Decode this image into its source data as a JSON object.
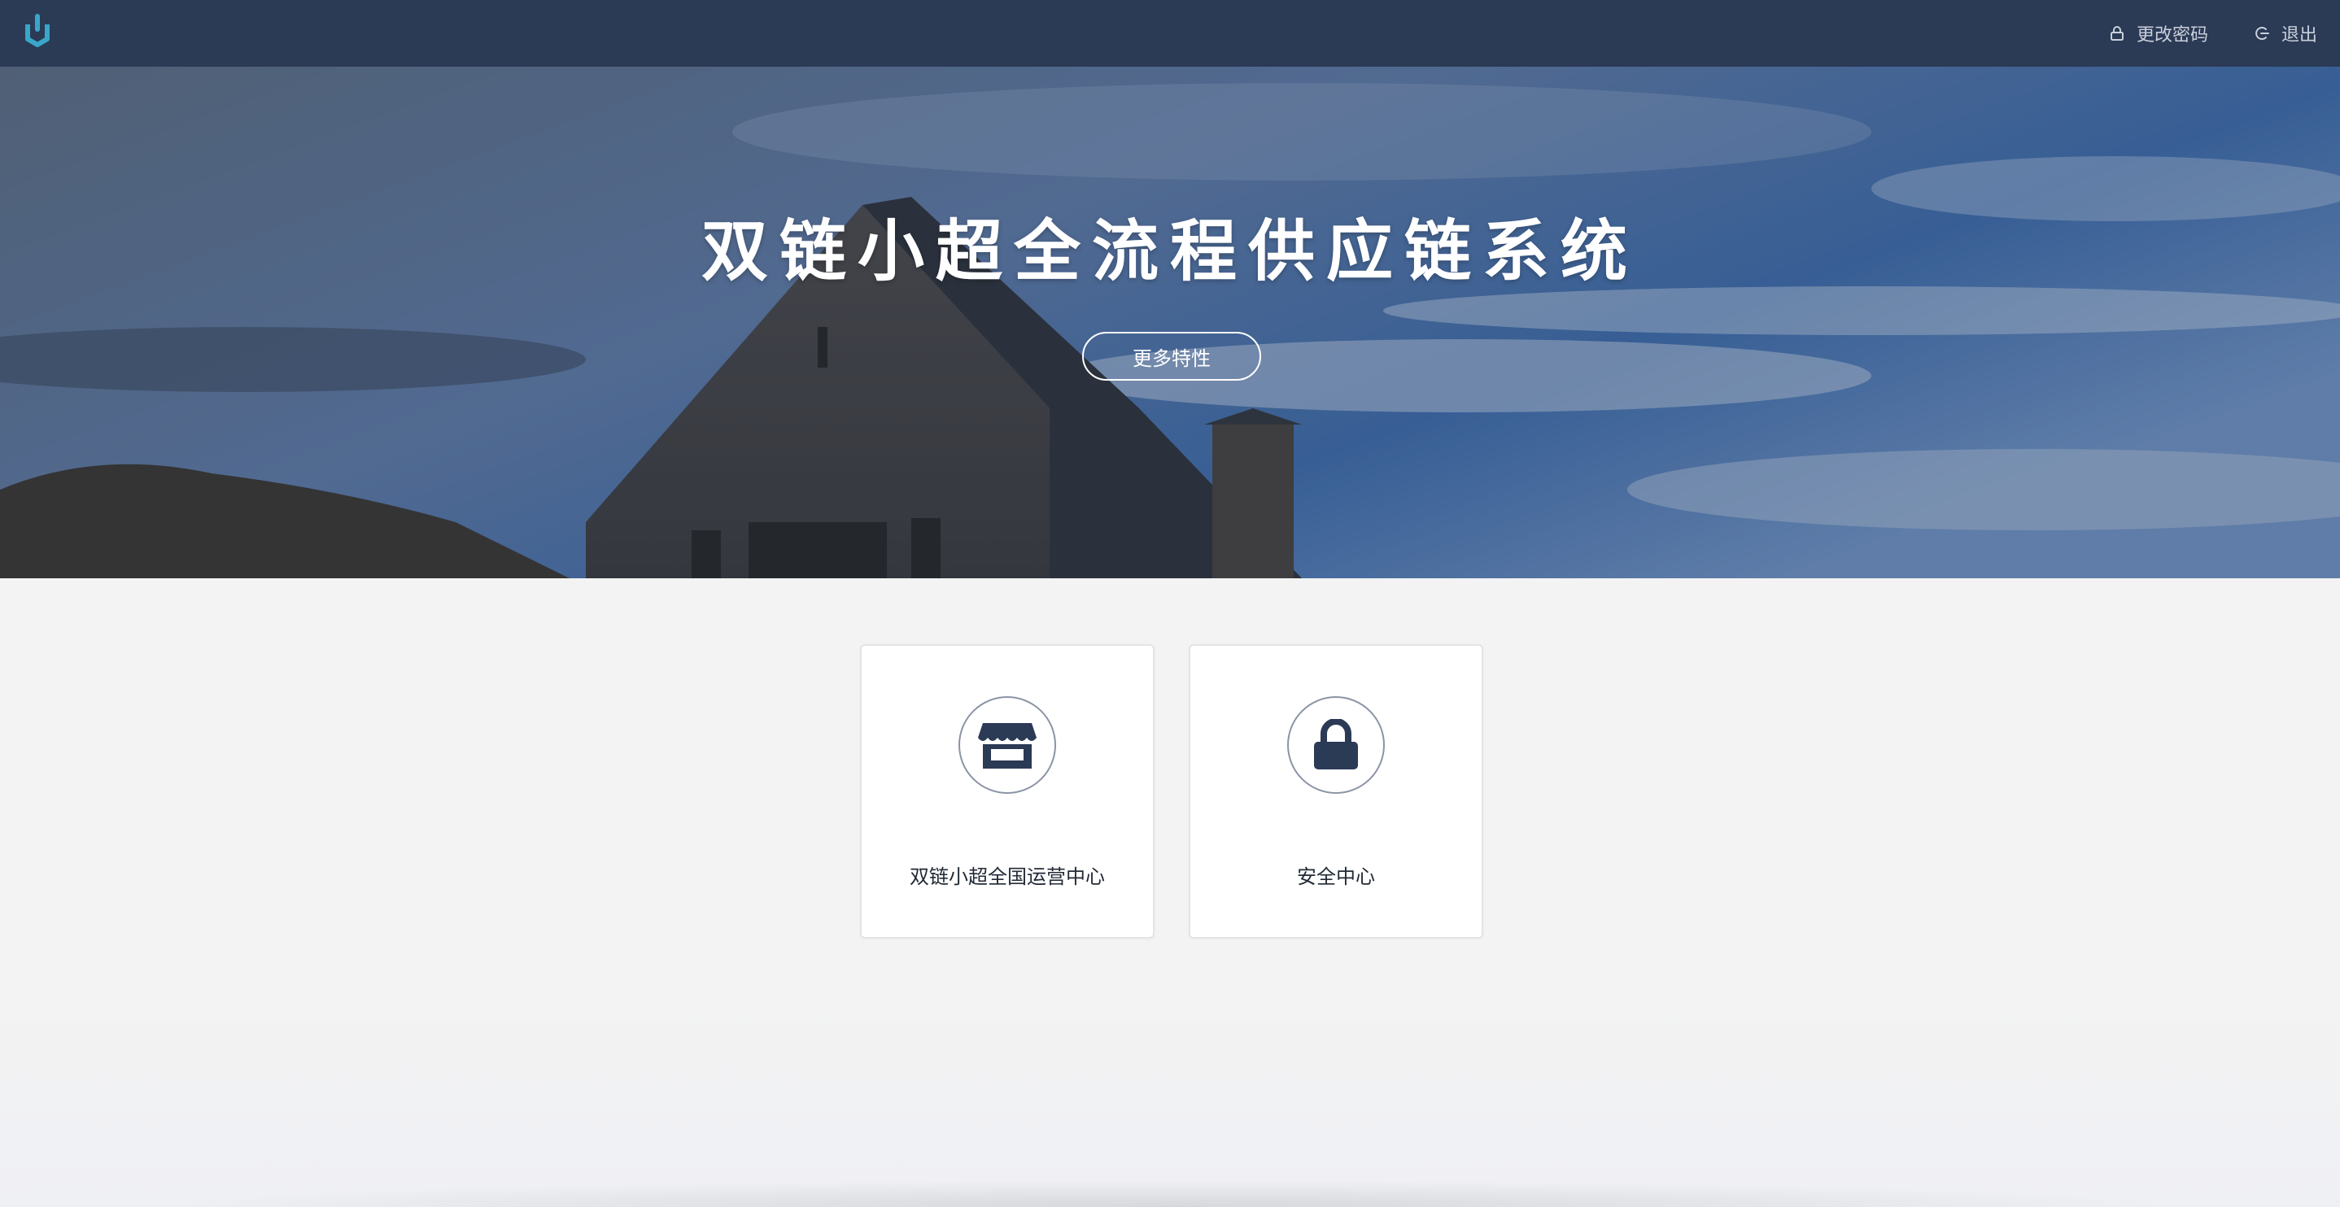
{
  "header": {
    "change_password_label": "更改密码",
    "logout_label": "退出"
  },
  "hero": {
    "title": "双链小超全流程供应链系统",
    "button_label": "更多特性"
  },
  "cards": [
    {
      "label": "双链小超全国运营中心",
      "icon": "storefront-icon"
    },
    {
      "label": "安全中心",
      "icon": "lock-icon"
    }
  ],
  "colors": {
    "header_bg": "#2b3a55",
    "logo_accent": "#3aa6c9",
    "icon_dark": "#2b3a55"
  }
}
